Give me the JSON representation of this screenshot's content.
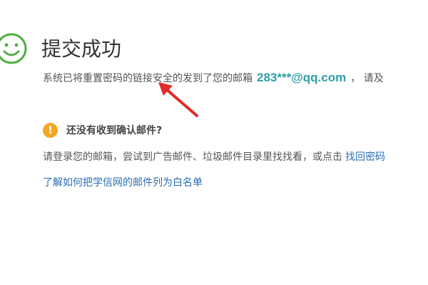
{
  "success": {
    "icon": "smiley-icon",
    "title": "提交成功",
    "message_prefix": "系统已将重置密码的链接安全的发到了您的邮箱",
    "email": "283***@qq.com",
    "message_suffix": "， 请及"
  },
  "notice": {
    "icon": "warning-icon",
    "icon_glyph": "!",
    "title": "还没有收到确认邮件?",
    "help_text": "请登录您的邮箱，尝试到广告邮件、垃圾邮件目录里找找看，或点击",
    "retrieve_link": "找回密码",
    "whitelist_link": "了解如何把学信网的邮件列为白名单"
  },
  "annotation": {
    "icon": "red-arrow-icon"
  },
  "colors": {
    "success_green": "#4caf3e",
    "email_teal": "#2d9fa8",
    "warning_orange": "#f5a623",
    "link_blue": "#2a6db5",
    "arrow_red": "#e32b2b"
  }
}
